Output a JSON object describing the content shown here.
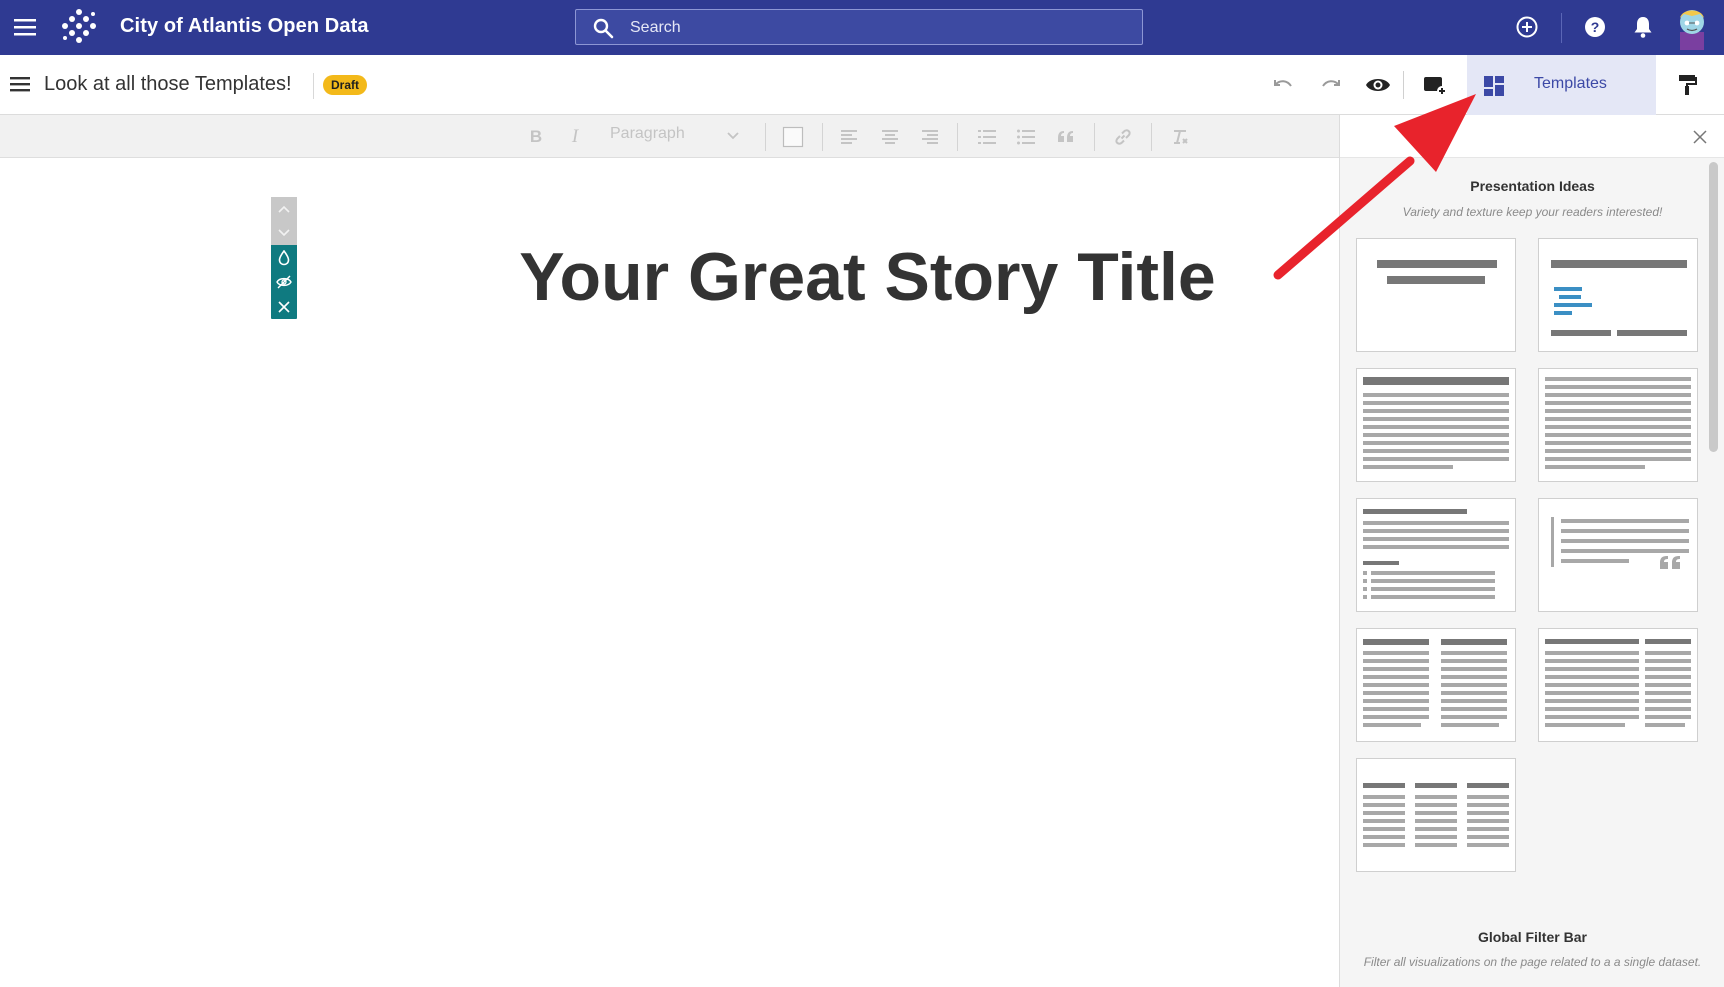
{
  "topbar": {
    "app_title": "City of Atlantis Open Data",
    "search_placeholder": "Search",
    "colors": {
      "background": "#2f3a92"
    }
  },
  "subbar": {
    "doc_title": "Look at all those Templates!",
    "draft_badge": "Draft",
    "templates_label": "Templates"
  },
  "toolbar": {
    "paragraph_label": "Paragraph"
  },
  "editor": {
    "story_title": "Your Great Story Title"
  },
  "panel": {
    "presentation_title": "Presentation Ideas",
    "presentation_subtitle": "Variety and texture keep your readers interested!",
    "filter_title": "Global Filter Bar",
    "filter_subtitle": "Filter all visualizations on the page related to a a single dataset."
  },
  "colors": {
    "accent": "#3c49a6",
    "badge": "#f3b91a",
    "block_controls": "#0f7a80",
    "arrow": "#e8232c"
  }
}
